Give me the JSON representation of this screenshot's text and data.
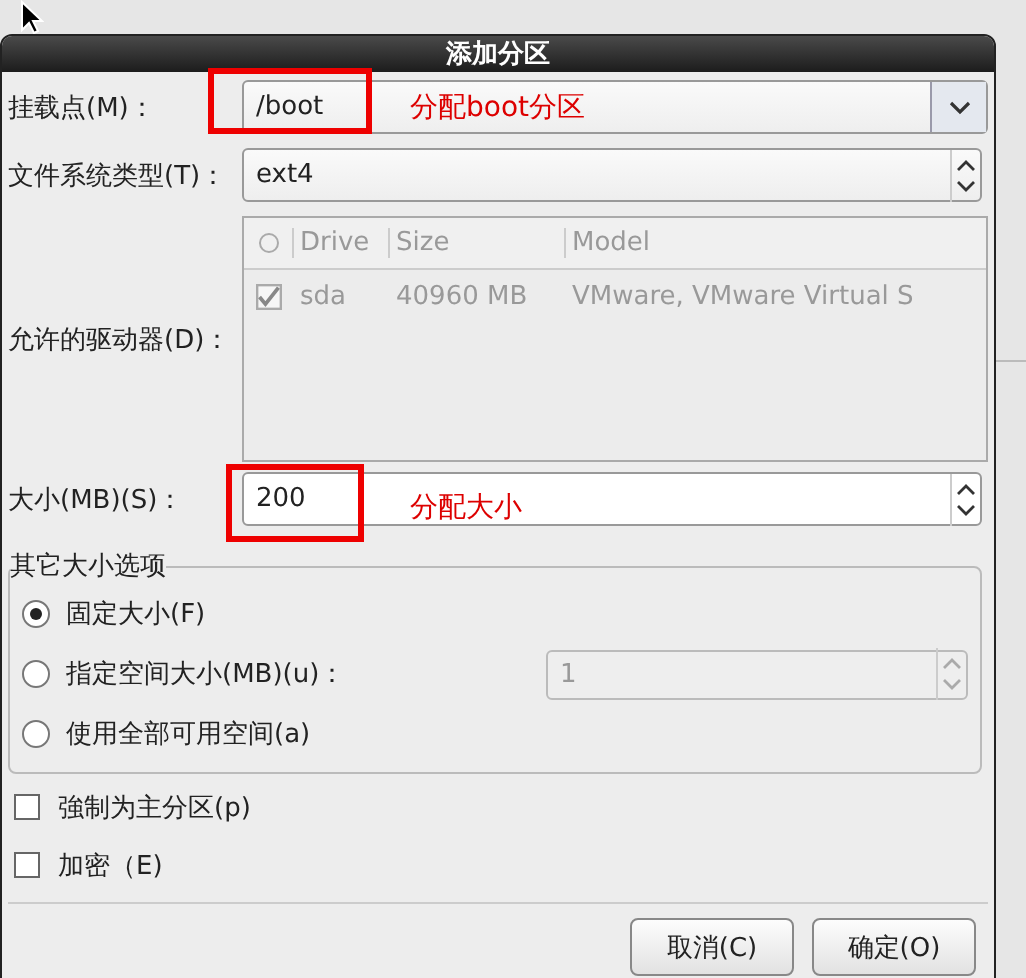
{
  "dialog": {
    "title": "添加分区"
  },
  "mount_point": {
    "label": "挂载点(M)：",
    "value": "/boot",
    "annotation": "分配boot分区"
  },
  "filesystem": {
    "label": "文件系统类型(T)：",
    "value": "ext4"
  },
  "drives": {
    "label": "允许的驱动器(D)：",
    "disabled": true,
    "columns": [
      "Drive",
      "Size",
      "Model"
    ],
    "rows": [
      {
        "checked": true,
        "cells": [
          "sda",
          "40960 MB",
          "VMware, VMware Virtual S"
        ]
      }
    ]
  },
  "size": {
    "label": "大小(MB)(S)：",
    "value": "200",
    "annotation": "分配大小"
  },
  "size_options": {
    "title": "其它大小选项",
    "options": [
      {
        "label": "固定大小(F)",
        "selected": true
      },
      {
        "label": "指定空间大小(MB)(u)：",
        "selected": false,
        "field": {
          "value": "1",
          "disabled": true
        }
      },
      {
        "label": "使用全部可用空间(a)",
        "selected": false
      }
    ]
  },
  "checkboxes": [
    {
      "label": "強制为主分区(p)",
      "checked": false
    },
    {
      "label": "加密（E)",
      "checked": false
    }
  ],
  "buttons": [
    "取消(C)",
    "确定(O)"
  ]
}
